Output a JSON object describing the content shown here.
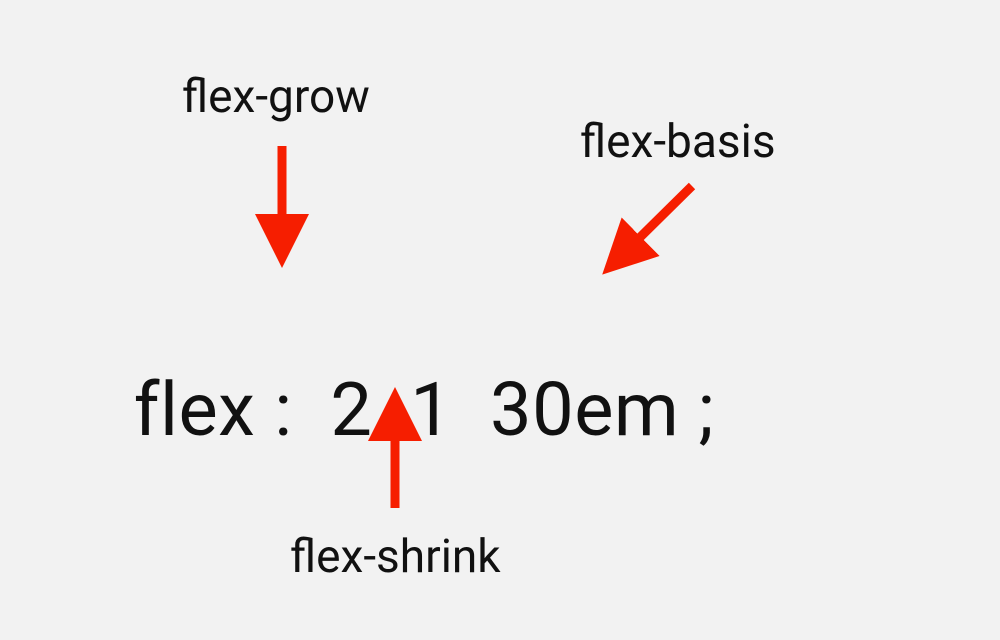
{
  "labels": {
    "grow": "flex-grow",
    "shrink": "flex-shrink",
    "basis": "flex-basis"
  },
  "code": {
    "property": "flex",
    "colon": ":",
    "grow_value": "2",
    "shrink_value": "1",
    "basis_value": "30em",
    "terminator": ";"
  },
  "colors": {
    "arrow": "#f61e00",
    "text": "#111111",
    "bg": "#f2f2f2"
  }
}
